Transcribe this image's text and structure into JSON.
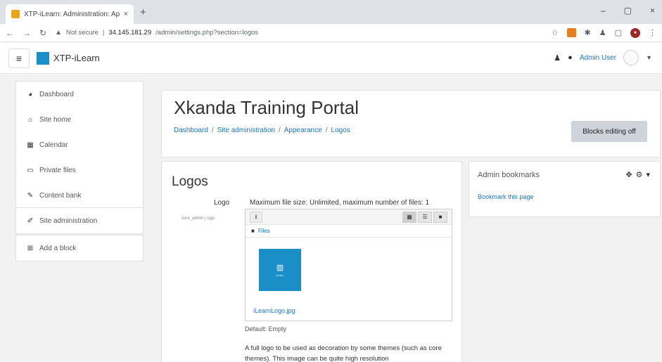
{
  "browser": {
    "tab_title": "XTP-iLearn: Administration: App...",
    "tab_close": "×",
    "new_tab": "+",
    "win_min": "–",
    "win_max": "▢",
    "win_close": "×",
    "security_label": "Not secure",
    "url_host": "34.145.181.29",
    "url_path": "/admin/settings.php?section=logos",
    "url_sep": "|"
  },
  "navbar": {
    "brand": "XTP-iLearn",
    "username": "Admin User"
  },
  "leftnav": {
    "primary": [
      {
        "label": "Dashboard",
        "icon": "dashboard-icon"
      },
      {
        "label": "Site home",
        "icon": "home-icon"
      },
      {
        "label": "Calendar",
        "icon": "calendar-icon"
      },
      {
        "label": "Private files",
        "icon": "file-icon"
      },
      {
        "label": "Content bank",
        "icon": "pencil-icon"
      }
    ],
    "admin": {
      "label": "Site administration",
      "icon": "wrench-icon"
    },
    "addblock": {
      "label": "Add a block",
      "icon": "plus-square-icon"
    }
  },
  "header": {
    "title": "Xkanda Training Portal",
    "breadcrumb": [
      "Dashboard",
      "Site administration",
      "Appearance",
      "Logos"
    ],
    "blocks_button": "Blocks editing off"
  },
  "main": {
    "heading": "Logos",
    "setting_label": "Logo",
    "setting_id": "core_admin | logo",
    "max_size": "Maximum file size: Unlimited, maximum number of files: 1",
    "path_label": "Files",
    "file_name": "iLearnLogo.jpg",
    "thumb_text": "iLearn",
    "default": "Default: Empty",
    "description": "A full logo to be used as decoration by some themes (such as core themes). This image can be quite high resolution"
  },
  "sideblock": {
    "title": "Admin bookmarks",
    "link": "Bookmark this page"
  },
  "colors": {
    "brand": "#1a8fc7",
    "link": "#1a73c8",
    "page_bg": "#f2f2f2"
  }
}
